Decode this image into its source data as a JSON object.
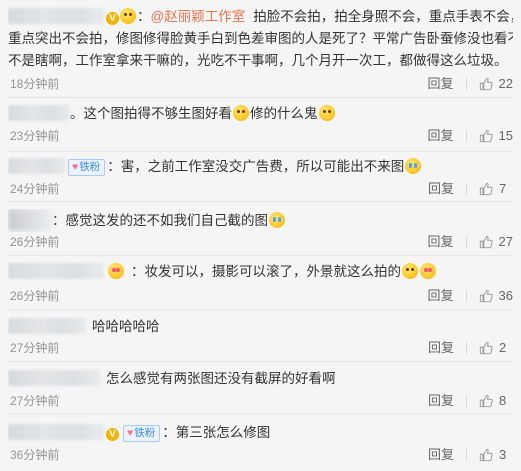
{
  "comments": [
    {
      "mention": "@赵丽颖工作室",
      "text_line1": "拍脸不会拍，拍全身照不会，重点手表不会，腰身",
      "text_line2": "重点突出不会拍，修图修得脸黄手白到色差审图的人是死了？平常广告卧蚕修没也看不到，是",
      "text_line3": "不是瞎啊，工作室拿来干嘛的，光吃不干事啊，几个月开一次工，都做得这么垃圾。",
      "time": "18分钟前",
      "reply": "回复",
      "likes": "22"
    },
    {
      "text_a": "。这个图拍得不够生图好看",
      "text_b": "修的什么鬼",
      "time": "23分钟前",
      "reply": "回复",
      "likes": "15"
    },
    {
      "badge": "铁粉",
      "text": "：害，之前工作室没交广告费，所以可能出不来图",
      "time": "24分钟前",
      "reply": "回复",
      "likes": "7"
    },
    {
      "text": "：感觉这发的还不如我们自己截的图",
      "time": "26分钟前",
      "reply": "回复",
      "likes": "27"
    },
    {
      "text": "：妆发可以，摄影可以滚了，外景就这么拍的",
      "time": "26分钟前",
      "reply": "回复",
      "likes": "36"
    },
    {
      "text": "哈哈哈哈哈",
      "time": "27分钟前",
      "reply": "回复",
      "likes": "2"
    },
    {
      "text": "怎么感觉有两张图还没有截屏的好看啊",
      "time": "27分钟前",
      "reply": "回复",
      "likes": "8"
    },
    {
      "badge": "铁粉",
      "text": "：第三张怎么修图",
      "time": "36分钟前",
      "reply": "回复",
      "likes": "3"
    }
  ],
  "icons": {
    "like": "thumbs-up-icon",
    "vip_badge": "vip-v-badge-icon",
    "emoji": "smiley-emoji-icon"
  },
  "colors": {
    "mention": "#eb7350",
    "badge_text": "#3a8ef0",
    "meta": "#939393",
    "background": "#f5f5f5"
  }
}
